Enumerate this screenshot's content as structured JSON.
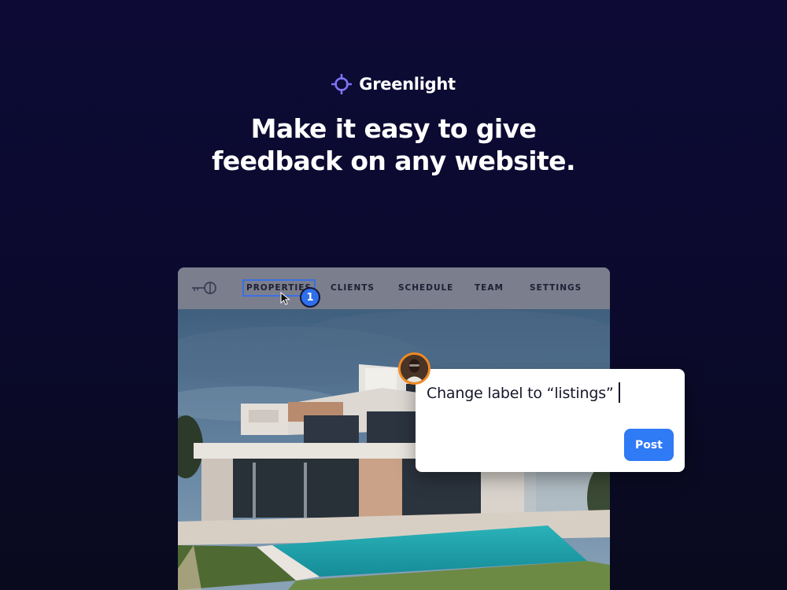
{
  "brand": {
    "name": "Greenlight",
    "icon": "crosshair-icon",
    "icon_color": "#7d74f5"
  },
  "headline": {
    "line1": "Make it easy to give",
    "line2": "feedback on any website."
  },
  "mockup": {
    "logo_icon": "key-logo-icon",
    "nav": [
      {
        "label": "PROPERTIES",
        "selected": true
      },
      {
        "label": "CLIENTS"
      },
      {
        "label": "SCHEDULE"
      },
      {
        "label": "TEAM"
      },
      {
        "label": "SETTINGS"
      }
    ],
    "marker_number": "1",
    "marker_color": "#2f6fec",
    "selection_color": "#3b6fe3"
  },
  "comment": {
    "text": "Change label to “listings”",
    "post_label": "Post",
    "post_color": "#2f7af5",
    "avatar_ring_color": "#f08a24"
  }
}
